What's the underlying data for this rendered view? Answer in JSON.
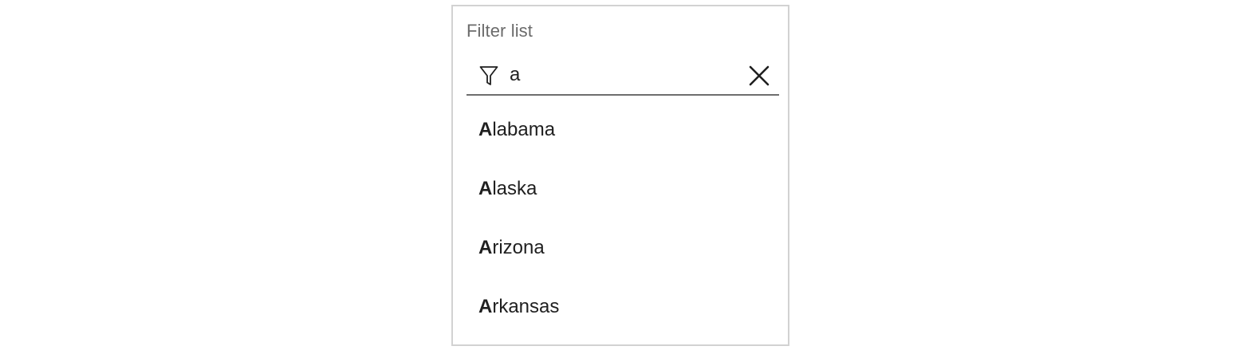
{
  "filter": {
    "label": "Filter list",
    "query": "a",
    "filter_icon": "filter-funnel-icon",
    "clear_icon": "close-icon"
  },
  "options": [
    {
      "match": "A",
      "rest": "labama"
    },
    {
      "match": "A",
      "rest": "laska"
    },
    {
      "match": "A",
      "rest": "rizona"
    },
    {
      "match": "A",
      "rest": "rkansas"
    }
  ]
}
